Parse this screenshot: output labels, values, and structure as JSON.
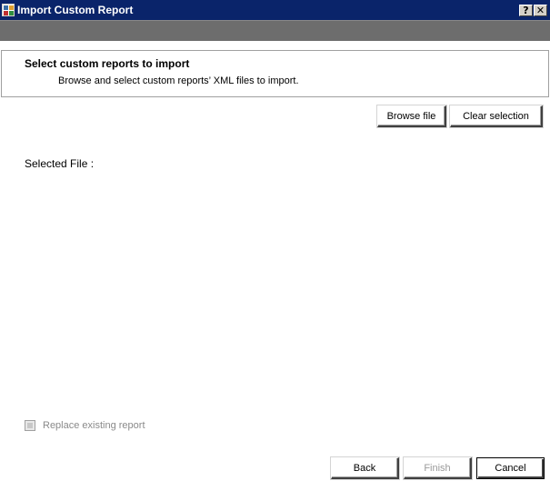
{
  "window": {
    "title": "Import Custom Report",
    "help_label": "?",
    "close_label": "✕"
  },
  "header": {
    "title": "Select custom reports to import",
    "subtitle": "Browse and select custom reports’ XML files to import."
  },
  "toolbar": {
    "browse_label": "Browse file",
    "clear_label": "Clear selection"
  },
  "main": {
    "selected_file_label": "Selected File :"
  },
  "options": {
    "replace_label": "Replace existing report",
    "replace_checked": false,
    "replace_enabled": false
  },
  "footer": {
    "back_label": "Back",
    "finish_label": "Finish",
    "cancel_label": "Cancel"
  },
  "colors": {
    "titlebar": "#0a246a",
    "band": "#6d6d6d",
    "disabled_text": "#9a9a9a"
  }
}
